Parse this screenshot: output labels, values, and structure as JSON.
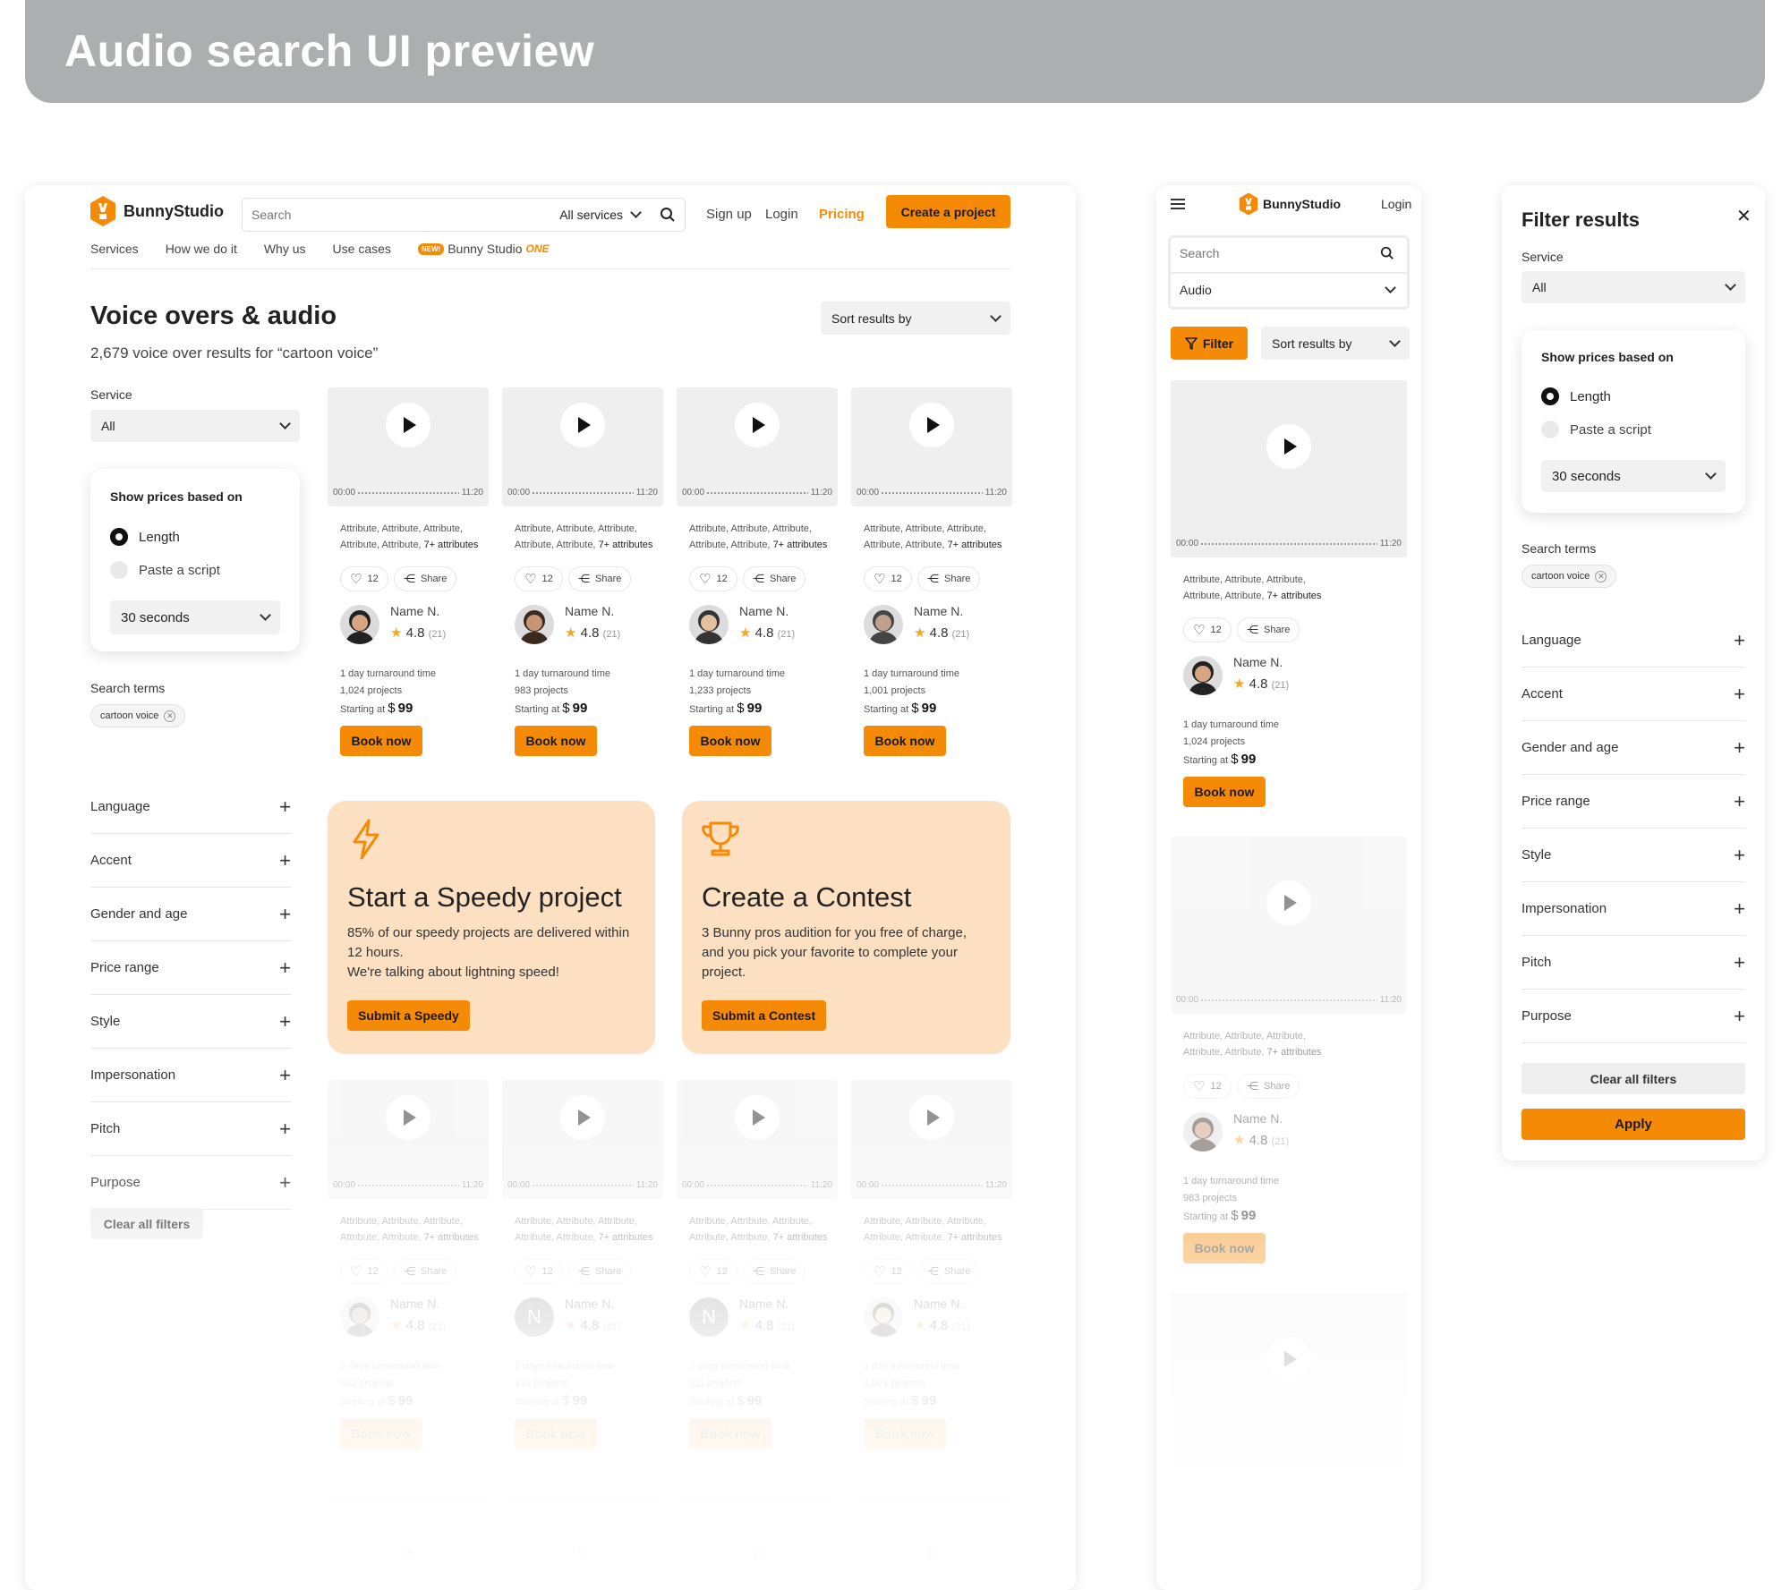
{
  "banner": {
    "title": "Audio search UI preview"
  },
  "colors": {
    "accent": "#f58a07",
    "promo_bg": "#fde0c2",
    "banner": "#adaeaf"
  },
  "brand": {
    "name": "BunnyStudio",
    "logo_icon": "bunny-logo-icon"
  },
  "header": {
    "search_placeholder": "Search",
    "services_select": "All services",
    "signup": "Sign up",
    "login": "Login",
    "pricing": "Pricing",
    "create_project": "Create a project"
  },
  "nav": {
    "items": [
      "Services",
      "How we do it",
      "Why us",
      "Use cases"
    ],
    "new_badge": "NEW!",
    "bunny_one": "Bunny Studio",
    "one": "ONE"
  },
  "page": {
    "title": "Voice overs & audio",
    "subtitle": "2,679 voice over results for “cartoon voice”",
    "sort": "Sort results by"
  },
  "filters": {
    "service_label": "Service",
    "service_value": "All",
    "prices_title": "Show prices based on",
    "opt_length": "Length",
    "opt_script": "Paste a script",
    "length_value": "30 seconds",
    "search_terms_label": "Search terms",
    "chip": "cartoon voice",
    "accordion": [
      "Language",
      "Accent",
      "Gender and age",
      "Price range",
      "Style",
      "Impersonation",
      "Pitch",
      "Purpose"
    ],
    "clear": "Clear all filters",
    "apply": "Apply",
    "panel_title": "Filter results"
  },
  "player": {
    "start": "00:00",
    "end": "11:20"
  },
  "card_common": {
    "attr1": "Attribute, Attribute, Attribute,",
    "attr2a": "Attribute, Attribute,",
    "attr2b": "7+ attributes",
    "likes": "12",
    "share": "Share",
    "name": "Name N.",
    "rating": "4.8",
    "reviews": "(21)",
    "starting": "Starting at",
    "currency": "$",
    "price": "99",
    "book": "Book now"
  },
  "cards_row1": [
    {
      "turnaround": "1 day turnaround time",
      "projects": "1,024 projects"
    },
    {
      "turnaround": "1 day turnaround time",
      "projects": "983 projects"
    },
    {
      "turnaround": "1 day turnaround time",
      "projects": "1,233 projects"
    },
    {
      "turnaround": "1 day turnaround time",
      "projects": "1,001 projects"
    }
  ],
  "cards_row2": [
    {
      "turnaround": "2 days turnaround time",
      "projects": "822 projects"
    },
    {
      "turnaround": "2 days turnaround time",
      "projects": "131 projects",
      "initial": "N"
    },
    {
      "turnaround": "2 days turnaround time",
      "projects": "311 projects"
    },
    {
      "turnaround": "1 day turnaround time",
      "projects": "1,001 projects"
    }
  ],
  "promos": [
    {
      "icon": "lightning-icon",
      "title": "Start a Speedy project",
      "l1": "85% of our speedy projects are delivered within",
      "l2": "12 hours.",
      "l3": "We're talking about lightning speed!",
      "button": "Submit a Speedy"
    },
    {
      "icon": "trophy-icon",
      "title": "Create a Contest",
      "l1": "3 Bunny pros audition for you free of charge,",
      "l2": "and you pick your favorite to complete your",
      "l3": "project.",
      "button": "Submit a Contest"
    }
  ],
  "mobile": {
    "login": "Login",
    "search_placeholder": "Search",
    "category": "Audio",
    "filter": "Filter",
    "sort": "Sort results by",
    "cards": [
      {
        "turnaround": "1 day turnaround time",
        "projects": "1,024 projects"
      },
      {
        "turnaround": "1 day turnaround time",
        "projects": "983 projects"
      }
    ]
  }
}
